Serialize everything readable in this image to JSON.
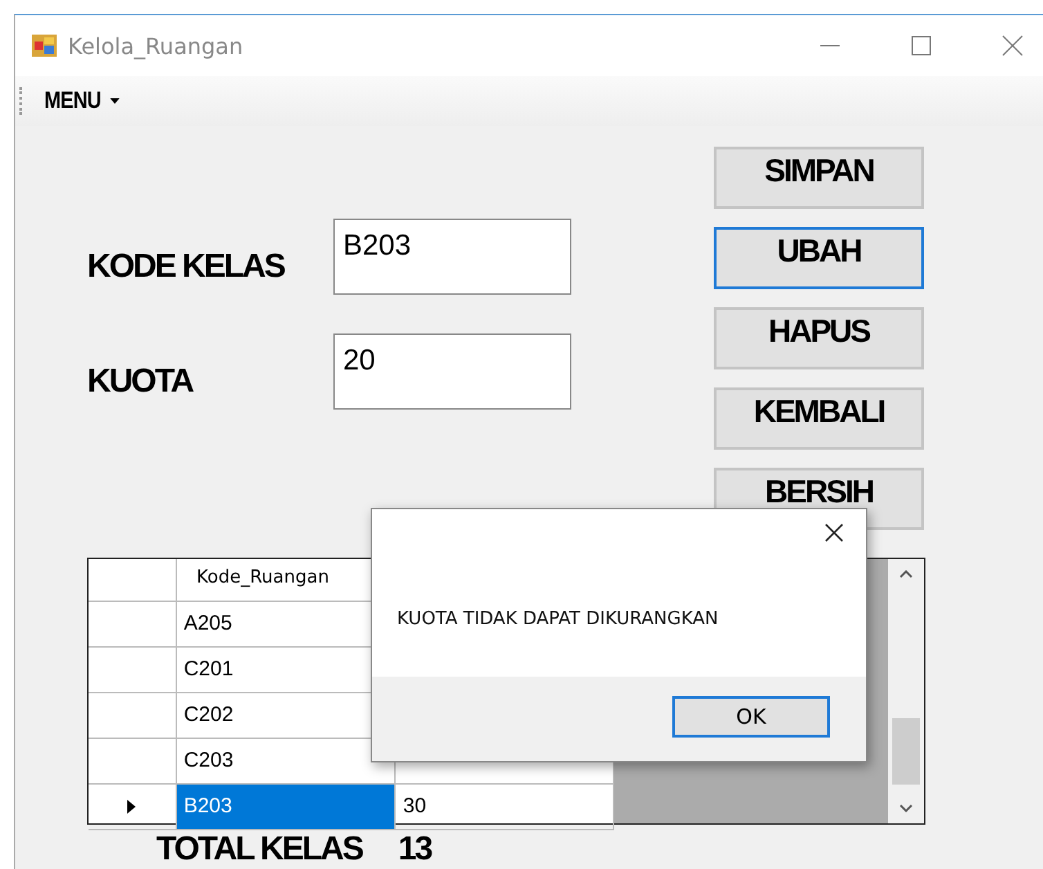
{
  "window": {
    "title": "Kelola_Ruangan"
  },
  "menu": {
    "label": "MENU"
  },
  "fields": [
    {
      "label": "KODE KELAS",
      "value": "B203"
    },
    {
      "label": "KUOTA",
      "value": "20"
    }
  ],
  "buttons": [
    {
      "label": "SIMPAN",
      "focused": false
    },
    {
      "label": "UBAH",
      "focused": true
    },
    {
      "label": "HAPUS",
      "focused": false
    },
    {
      "label": "KEMBALI",
      "focused": false
    },
    {
      "label": "BERSIH",
      "focused": false
    }
  ],
  "table": {
    "columns": [
      "Kode_Ruangan"
    ],
    "rows": [
      {
        "cells": [
          "A205"
        ],
        "selected": false
      },
      {
        "cells": [
          "C201"
        ],
        "selected": false
      },
      {
        "cells": [
          "C202"
        ],
        "selected": false
      },
      {
        "cells": [
          "C203"
        ],
        "selected": false
      },
      {
        "cells": [
          "B203",
          "30"
        ],
        "selected": true
      }
    ]
  },
  "total": {
    "label": "TOTAL KELAS",
    "value": "13"
  },
  "dialog": {
    "message": "KUOTA TIDAK DAPAT DIKURANGKAN",
    "button": "OK"
  }
}
